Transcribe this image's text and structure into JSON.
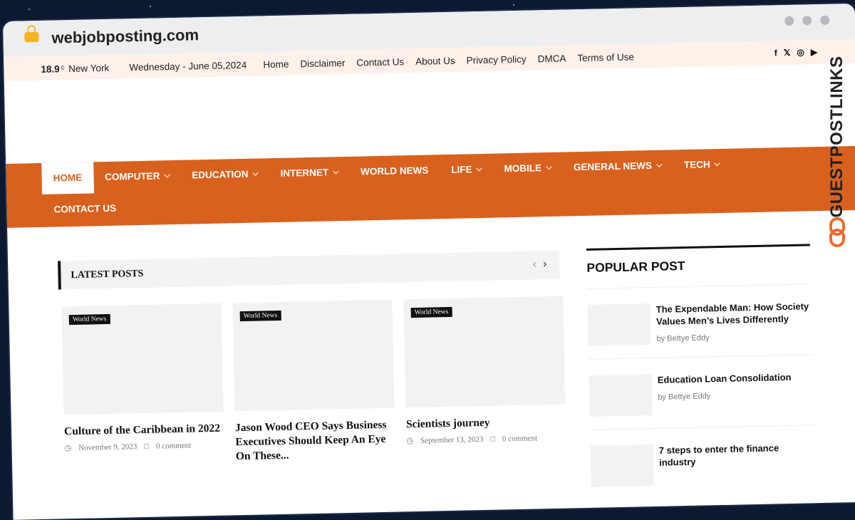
{
  "browser": {
    "url": "webjobposting.com"
  },
  "topbar": {
    "temp": "18.9",
    "temp_unit": "c",
    "city": "New York",
    "date": "Wednesday - June 05,2024",
    "links": [
      "Home",
      "Disclaimer",
      "Contact Us",
      "About Us",
      "Privacy Policy",
      "DMCA",
      "Terms of Use"
    ],
    "social": [
      "facebook-icon",
      "twitter-icon",
      "instagram-icon",
      "youtube-icon"
    ]
  },
  "nav": {
    "items": [
      {
        "label": "HOME",
        "active": true,
        "dropdown": false
      },
      {
        "label": "COMPUTER",
        "dropdown": true
      },
      {
        "label": "EDUCATION",
        "dropdown": true
      },
      {
        "label": "INTERNET",
        "dropdown": true
      },
      {
        "label": "WORLD NEWS",
        "dropdown": false
      },
      {
        "label": "LIFE",
        "dropdown": true
      },
      {
        "label": "MOBILE",
        "dropdown": true
      },
      {
        "label": "GENERAL NEWS",
        "dropdown": true
      },
      {
        "label": "TECH",
        "dropdown": true
      },
      {
        "label": "CONTACT US",
        "dropdown": false
      }
    ],
    "accent": "#d9611e"
  },
  "latest": {
    "title": "LATEST POSTS",
    "posts": [
      {
        "category": "World News",
        "title": "Culture of the Caribbean in 2022",
        "date": "November 9, 2023",
        "comments": "0 comment"
      },
      {
        "category": "World News",
        "title": "Jason Wood CEO Says Business Executives Should Keep An Eye On These...",
        "date": "",
        "comments": ""
      },
      {
        "category": "World News",
        "title": "Scientists journey",
        "date": "September 13, 2023",
        "comments": "0 comment"
      }
    ]
  },
  "popular": {
    "title": "POPULAR POST",
    "posts": [
      {
        "title": "The Expendable Man: How Society Values Men’s Lives Differently",
        "by": "by",
        "author": "Bettye Eddy"
      },
      {
        "title": "Education Loan Consolidation",
        "by": "by",
        "author": "Bettye Eddy"
      },
      {
        "title": "7 steps to enter the finance industry",
        "by": "",
        "author": ""
      }
    ]
  },
  "watermark": {
    "text": "GUESTPOSTLINKS"
  }
}
